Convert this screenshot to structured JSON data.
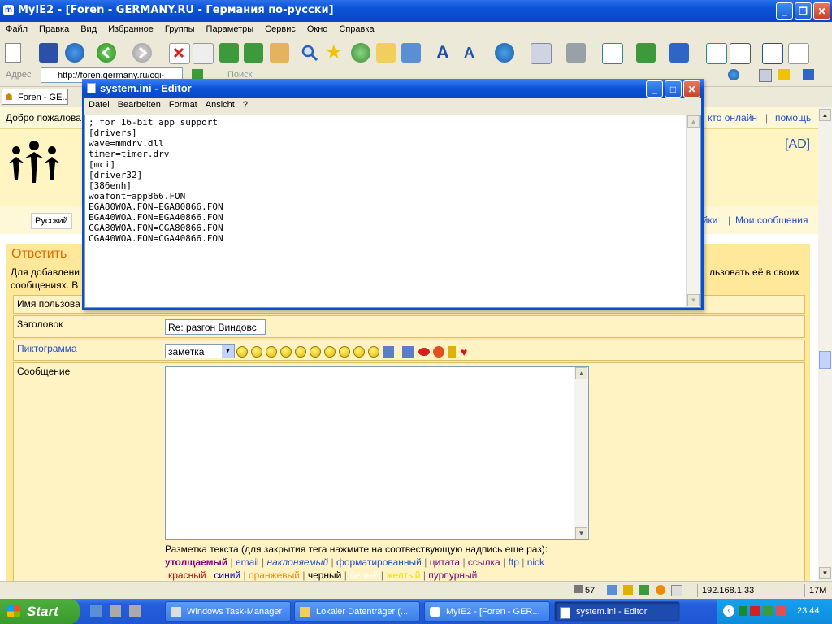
{
  "browser": {
    "title": "MyIE2 - [Foren - GERMANY.RU - Германия по-русски]",
    "menu": [
      "Файл",
      "Правка",
      "Вид",
      "Избранное",
      "Группы",
      "Параметры",
      "Сервис",
      "Окно",
      "Справка"
    ],
    "address_label": "Адрес",
    "address_value": "http://foren.germany.ru/cgi-",
    "search_label": "Поиск",
    "tab_label": "Foren - GE..."
  },
  "page": {
    "welcome": "Добро пожалова",
    "top_links": [
      "кто онлайн",
      "помощь"
    ],
    "ad": "[AD]",
    "lang_button": "Русский",
    "nav_links": [
      "ойки",
      "Мои сообщения"
    ],
    "reply_heading": "Ответить",
    "intro_left_1": "Для добавлени",
    "intro_left_2": "сообщениях. В",
    "intro_right": "льзовать её в своих",
    "form": {
      "username_label": "Имя пользова",
      "subject_label": "Заголовок",
      "subject_value": "Re: разгон Виндовс",
      "icon_label": "Пиктограмма",
      "icon_select": "заметка",
      "message_label": "Сообщение",
      "markup_hint": "Разметка текста (для закрытия тега нажмите на соотвествующую надпись еще раз):",
      "markup_tags": [
        "утолщаемый",
        "email",
        "наклоняемый",
        "форматированный",
        "цитата",
        "ссылка",
        "ftp",
        "nick"
      ],
      "colors": [
        "красный",
        "синий",
        "оранжевый",
        "черный",
        "белый",
        "желтый",
        "пурпурный"
      ]
    }
  },
  "status": {
    "count": "57",
    "ip": "192.168.1.33",
    "memory": "17M"
  },
  "taskbar": {
    "start": "Start",
    "tasks": [
      "Windows Task-Manager",
      "Lokaler Datenträger (...",
      "MyIE2 - [Foren - GER...",
      "system.ini - Editor"
    ],
    "clock": "23:44"
  },
  "notepad": {
    "title": "system.ini - Editor",
    "menu": [
      "Datei",
      "Bearbeiten",
      "Format",
      "Ansicht",
      "?"
    ],
    "content": "; for 16-bit app support\n[drivers]\nwave=mmdrv.dll\ntimer=timer.drv\n[mci]\n[driver32]\n[386enh]\nwoafont=app866.FON\nEGA80WOA.FON=EGA80866.FON\nEGA40WOA.FON=EGA40866.FON\nCGA80WOA.FON=CGA80866.FON\nCGA40WOA.FON=CGA40866.FON"
  },
  "colors": {
    "xp_blue": "#0A52D6",
    "start_green": "#3A9A2D",
    "page_yellow": "#FFE89A",
    "link_blue": "#1F4FCC",
    "reply_orange": "#E06A00"
  }
}
